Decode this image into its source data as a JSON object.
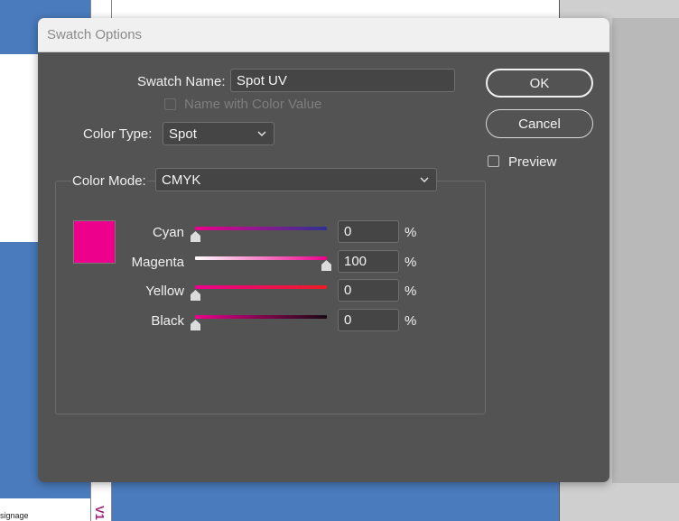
{
  "background": {
    "left_label": "signage",
    "strip_label": "V1"
  },
  "dialog": {
    "title": "Swatch Options",
    "swatch_name_label": "Swatch Name:",
    "swatch_name_value": "Spot UV",
    "name_with_color_value_label": "Name with Color Value",
    "name_with_color_value_checked": false,
    "color_type_label": "Color Type:",
    "color_type_value": "Spot",
    "color_mode_label": "Color Mode:",
    "color_mode_value": "CMYK",
    "swatch_color": "#ec008c",
    "buttons": {
      "ok": "OK",
      "cancel": "Cancel"
    },
    "preview_label": "Preview",
    "preview_checked": false,
    "channels": [
      {
        "name": "Cyan",
        "value": "0",
        "unit": "%",
        "level": 0
      },
      {
        "name": "Magenta",
        "value": "100",
        "unit": "%",
        "level": 1
      },
      {
        "name": "Yellow",
        "value": "0",
        "unit": "%",
        "level": 0
      },
      {
        "name": "Black",
        "value": "0",
        "unit": "%",
        "level": 0
      }
    ]
  },
  "icons": {
    "chevron": "chevron-down-icon",
    "thumb": "slider-thumb-icon"
  },
  "colors": {
    "dialog_bg": "#535353",
    "field_bg": "#454545",
    "accent_magenta": "#ec008c",
    "background_blue": "#4a7bbd"
  }
}
